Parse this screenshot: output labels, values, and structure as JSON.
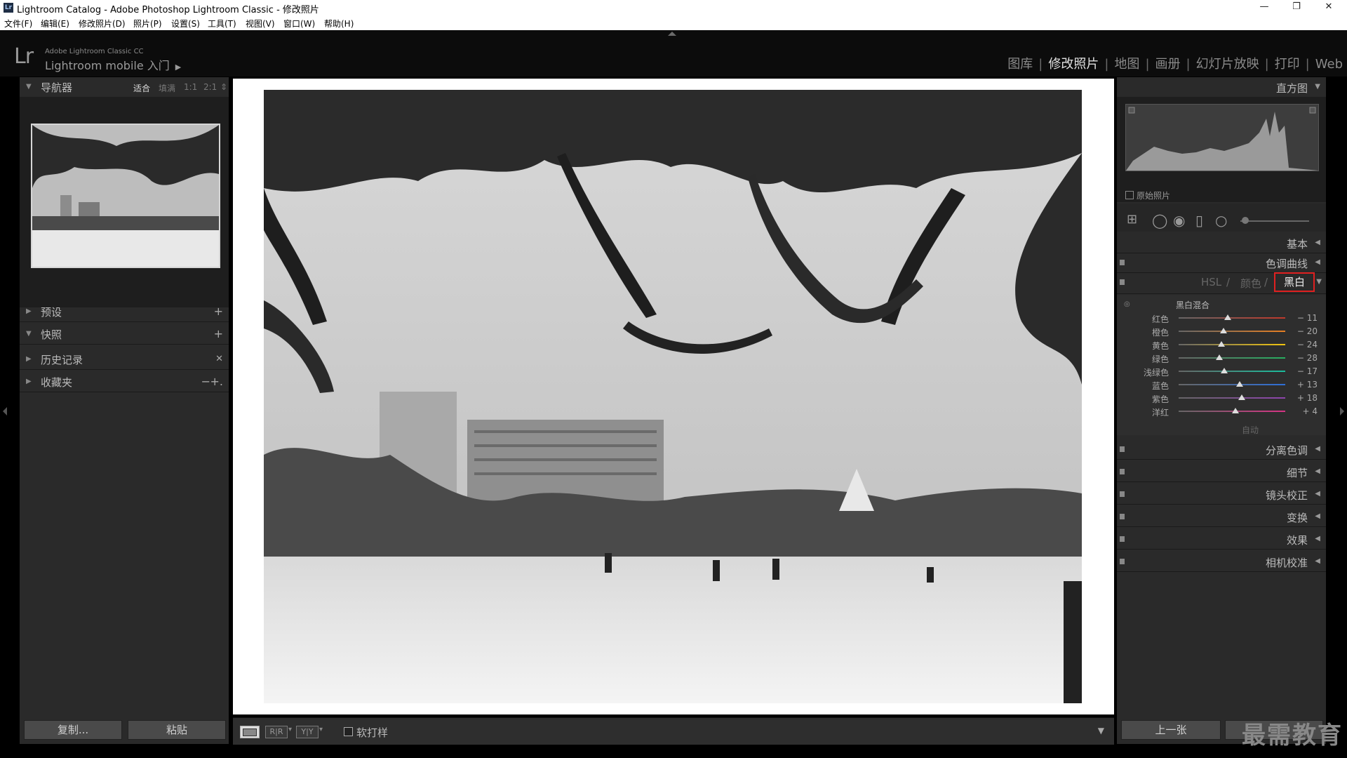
{
  "window": {
    "title": "Lightroom Catalog - Adobe Photoshop Lightroom Classic - 修改照片",
    "app_badge": "Lr",
    "minimize": "—",
    "maximize": "❐",
    "close": "✕"
  },
  "menu": [
    "文件(F)",
    "编辑(E)",
    "修改照片(D)",
    "照片(P)",
    "设置(S)",
    "工具(T)",
    "视图(V)",
    "窗口(W)",
    "帮助(H)"
  ],
  "identity": {
    "logo": "Lr",
    "line1": "Adobe Lightroom Classic CC",
    "line2": "Lightroom mobile 入门"
  },
  "modules": [
    "图库",
    "修改照片",
    "地图",
    "画册",
    "幻灯片放映",
    "打印",
    "Web"
  ],
  "active_module": "修改照片",
  "left_panel": {
    "navigator": {
      "label": "导航器",
      "zoom": [
        "适合",
        "填满",
        "1:1",
        "2:1"
      ],
      "zoom_selected": "适合"
    },
    "presets": {
      "label": "预设",
      "action": "+"
    },
    "snapshots": {
      "label": "快照",
      "action": "+"
    },
    "history": {
      "label": "历史记录",
      "action": "✕"
    },
    "collections": {
      "label": "收藏夹",
      "action_minus": "−",
      "action_plus": "+."
    },
    "copy_button": "复制...",
    "paste_button": "粘贴"
  },
  "toolbar": {
    "view_loupe": "",
    "view_rr": "R|R",
    "view_yy": "Y|Y",
    "soft_proof_label": "软打样"
  },
  "right_panel": {
    "histogram_label": "直方图",
    "original_photo_label": "原始照片",
    "basic_label": "基本",
    "tone_curve_label": "色调曲线",
    "hsl_tabs": {
      "hsl": "HSL",
      "sep": "/",
      "color": "颜色",
      "bw": "黑白"
    },
    "bw_mix_title": "黑白混合",
    "bw_mix": [
      {
        "label": "红色",
        "value": "− 11",
        "pos": 0.46,
        "color": "#c0392b"
      },
      {
        "label": "橙色",
        "value": "− 20",
        "pos": 0.42,
        "color": "#e67e22"
      },
      {
        "label": "黄色",
        "value": "− 24",
        "pos": 0.4,
        "color": "#f1c40f"
      },
      {
        "label": "绿色",
        "value": "− 28",
        "pos": 0.38,
        "color": "#27ae60"
      },
      {
        "label": "浅绿色",
        "value": "− 17",
        "pos": 0.43,
        "color": "#1abc9c"
      },
      {
        "label": "蓝色",
        "value": "+ 13",
        "pos": 0.57,
        "color": "#2e6fd8"
      },
      {
        "label": "紫色",
        "value": "+ 18",
        "pos": 0.59,
        "color": "#8e44ad"
      },
      {
        "label": "洋红",
        "value": "+ 4",
        "pos": 0.53,
        "color": "#d63384"
      }
    ],
    "auto_label": "自动",
    "split_toning": "分离色调",
    "detail": "细节",
    "lens_corrections": "镜头校正",
    "transform": "变换",
    "effects": "效果",
    "camera_calibration": "相机校准",
    "previous_button": "上一张"
  },
  "watermark": "最需教育"
}
